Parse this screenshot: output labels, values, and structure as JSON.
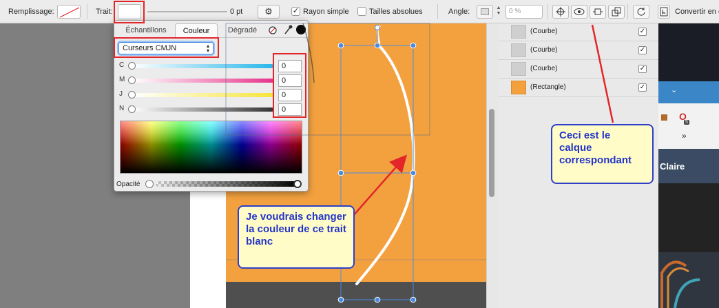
{
  "toolbar": {
    "fill_label": "Remplissage:",
    "stroke_label": "Trait:",
    "stroke_width": "0 pt",
    "simple_radius_label": "Rayon simple",
    "simple_radius_checked": "✓",
    "absolute_sizes_label": "Tailles absolues",
    "angle_label": "Angle:",
    "angle_value": "0 %",
    "convert_label": "Convertir en c"
  },
  "color_popover": {
    "tabs": [
      "Échantillons",
      "Couleur",
      "Dégradé"
    ],
    "active_tab": "Couleur",
    "mode_select": "Curseurs CMJN",
    "sliders": [
      {
        "letter": "C",
        "value": "0",
        "color": "#27b6ea"
      },
      {
        "letter": "M",
        "value": "0",
        "color": "#e6338a"
      },
      {
        "letter": "J",
        "value": "0",
        "color": "#f5e43a"
      },
      {
        "letter": "N",
        "value": "0",
        "color": "#333333"
      }
    ],
    "opacity_label": "Opacité"
  },
  "layers": [
    {
      "name": "(Courbe)",
      "checked": "✓"
    },
    {
      "name": "(Courbe)",
      "checked": "✓"
    },
    {
      "name": "(Courbe)",
      "checked": "✓"
    },
    {
      "name": "(Rectangle)",
      "checked": "✓"
    }
  ],
  "right_strip": {
    "panel_title": "Claire",
    "chevrons": "»",
    "badge": "5"
  },
  "callouts": {
    "stroke_note": "Je voudrais changer la couleur de ce trait blanc",
    "layer_note": "Ceci est le calque correspondant"
  },
  "colors": {
    "canvas_orange": "#f3a13f",
    "annotation_red": "#e2262a",
    "callout_blue": "#2e3fc9",
    "callout_bg": "#fffcc8",
    "selection_blue": "#4a8ae0"
  }
}
